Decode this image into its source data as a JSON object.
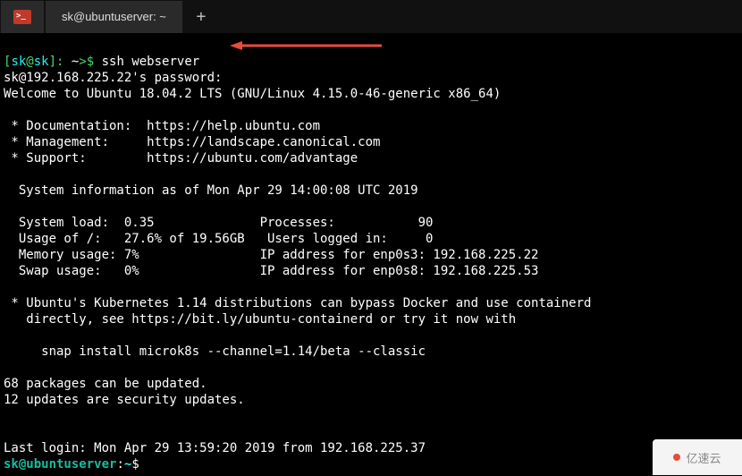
{
  "tabbar": {
    "tab_title": "sk@ubuntuserver: ~",
    "newtab_label": "+"
  },
  "prompt1": {
    "open": "[",
    "user": "sk",
    "at": "@",
    "host": "sk",
    "close": "]:",
    "path": " ~",
    "arrow": ">$ ",
    "command": "ssh webserver"
  },
  "login": {
    "password_line": "sk@192.168.225.22's password:",
    "welcome": "Welcome to Ubuntu 18.04.2 LTS (GNU/Linux 4.15.0-46-generic x86_64)"
  },
  "motd": {
    "doc": " * Documentation:  https://help.ubuntu.com",
    "mgmt": " * Management:     https://landscape.canonical.com",
    "support": " * Support:        https://ubuntu.com/advantage",
    "sysinfo_header": "  System information as of Mon Apr 29 14:00:08 UTC 2019",
    "line_load": "  System load:  0.35              Processes:           90",
    "line_usage": "  Usage of /:   27.6% of 19.56GB   Users logged in:     0",
    "line_mem": "  Memory usage: 7%                IP address for enp0s3: 192.168.225.22",
    "line_swap": "  Swap usage:   0%                IP address for enp0s8: 192.168.225.53",
    "k8s1": " * Ubuntu's Kubernetes 1.14 distributions can bypass Docker and use containerd",
    "k8s2": "   directly, see https://bit.ly/ubuntu-containerd or try it now with",
    "snap": "     snap install microk8s --channel=1.14/beta --classic",
    "updates1": "68 packages can be updated.",
    "updates2": "12 updates are security updates.",
    "lastlogin": "Last login: Mon Apr 29 13:59:20 2019 from 192.168.225.37"
  },
  "prompt2": {
    "userhost": "sk@ubuntuserver",
    "colon": ":",
    "path": "~",
    "dollar": "$"
  },
  "watermark": {
    "text": "亿速云"
  }
}
